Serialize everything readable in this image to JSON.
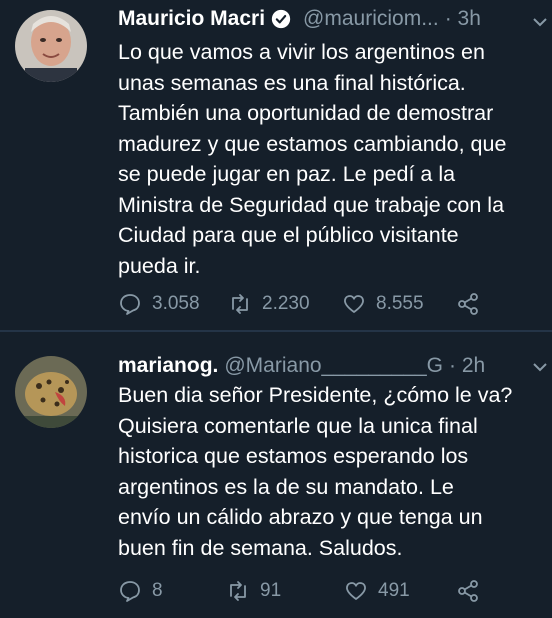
{
  "tweets": [
    {
      "name": "Mauricio Macri",
      "verified": true,
      "handle": "@mauriciom...",
      "time": "· 3h",
      "lines": [
        "Lo que vamos a vivir los argentinos en",
        "unas semanas es una final histórica.",
        "También una oportunidad de demostrar",
        "madurez y que estamos cambiando, que",
        "se puede jugar en paz. Le pedí a la",
        "Ministra de Seguridad que trabaje con la",
        "Ciudad para que el público visitante",
        "pueda ir."
      ],
      "replies": "3.058",
      "retweets": "2.230",
      "likes": "8.555"
    },
    {
      "name": "marianog.",
      "verified": false,
      "handle": "@Mariano_________G",
      "time": "· 2h",
      "lines": [
        "Buen dia señor Presidente, ¿cómo le va?",
        "Quisiera comentarle que la unica final",
        "historica que estamos esperando los",
        "argentinos es la de su mandato. Le",
        "envío un cálido abrazo y que tenga un",
        "buen fin de semana. Saludos."
      ],
      "replies": "8",
      "retweets": "91",
      "likes": "491"
    }
  ],
  "colors": {
    "background": "#151f2a",
    "text": "#ffffff",
    "muted": "#8899a6",
    "verified": "#ffffff"
  },
  "icons": [
    "reply-icon",
    "retweet-icon",
    "like-icon",
    "share-icon",
    "verified-icon",
    "chevron-down-icon"
  ]
}
